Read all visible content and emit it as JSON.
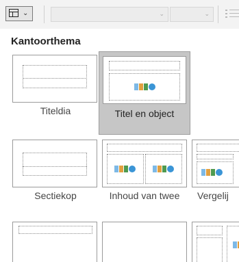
{
  "toolbar": {
    "layout_button_icon": "layout-icon",
    "chevron_icon": "chevron-down-icon",
    "list_icon": "bullet-list-icon"
  },
  "gallery": {
    "heading": "Kantoorthema",
    "layouts": [
      {
        "label": "Titeldia",
        "selected": false
      },
      {
        "label": "Titel en object",
        "selected": true
      },
      {
        "label": "Sectiekop",
        "selected": false
      },
      {
        "label": "Inhoud van twee",
        "selected": false
      },
      {
        "label": "Vergelij",
        "selected": false
      }
    ]
  },
  "colors": {
    "selected_bg": "#c6c6c6",
    "toolbar_bg": "#f3f3f3"
  }
}
